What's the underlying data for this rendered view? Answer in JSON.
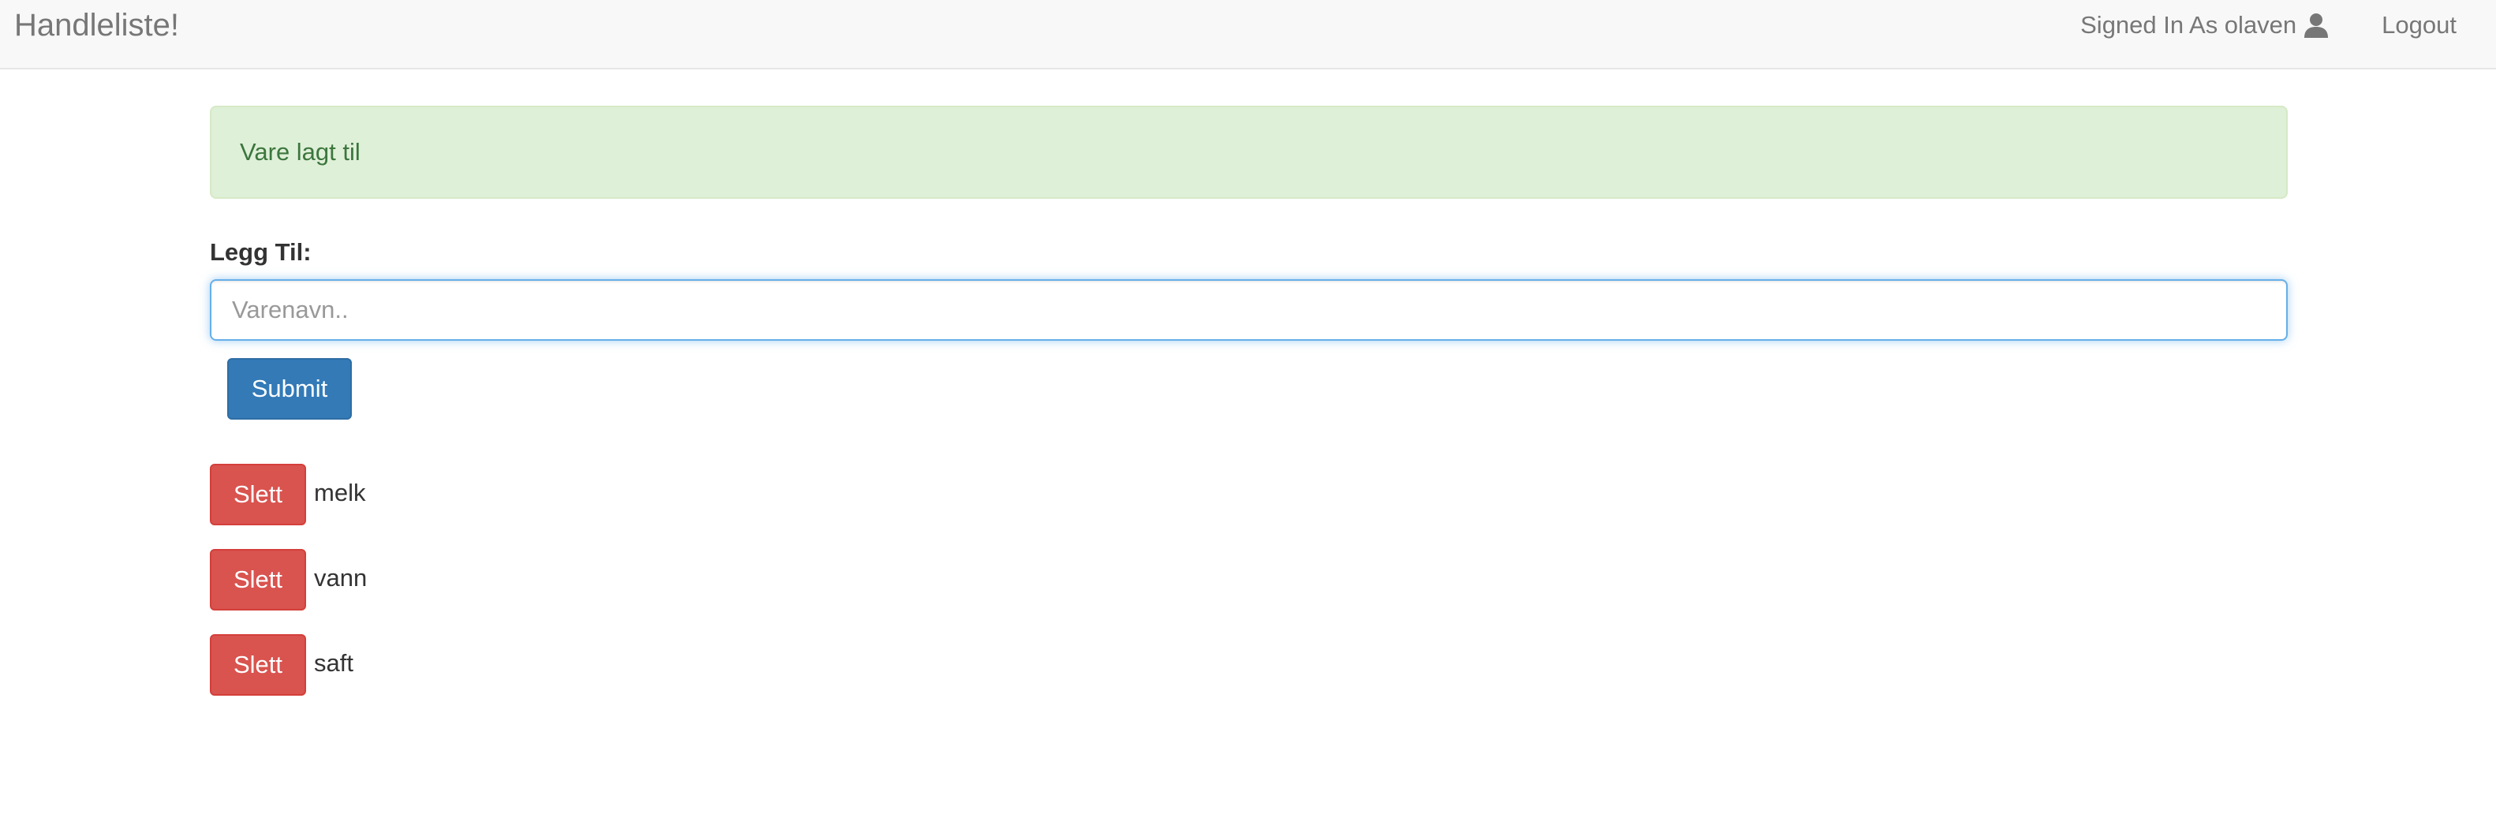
{
  "navbar": {
    "brand": "Handleliste!",
    "signed_in_text": "Signed In As olaven",
    "user_icon": "user-icon",
    "logout_label": "Logout"
  },
  "alert": {
    "message": "Vare lagt til",
    "color": "#3c763d",
    "background": "#dff0d8"
  },
  "form": {
    "label": "Legg Til:",
    "input_value": "",
    "input_placeholder": "Varenavn..",
    "submit_label": "Submit"
  },
  "items": [
    {
      "delete_label": "Slett",
      "name": "melk"
    },
    {
      "delete_label": "Slett",
      "name": "vann"
    },
    {
      "delete_label": "Slett",
      "name": "saft"
    }
  ],
  "colors": {
    "primary": "#337ab7",
    "danger": "#d9534f",
    "navbar_bg": "#f8f8f8"
  }
}
